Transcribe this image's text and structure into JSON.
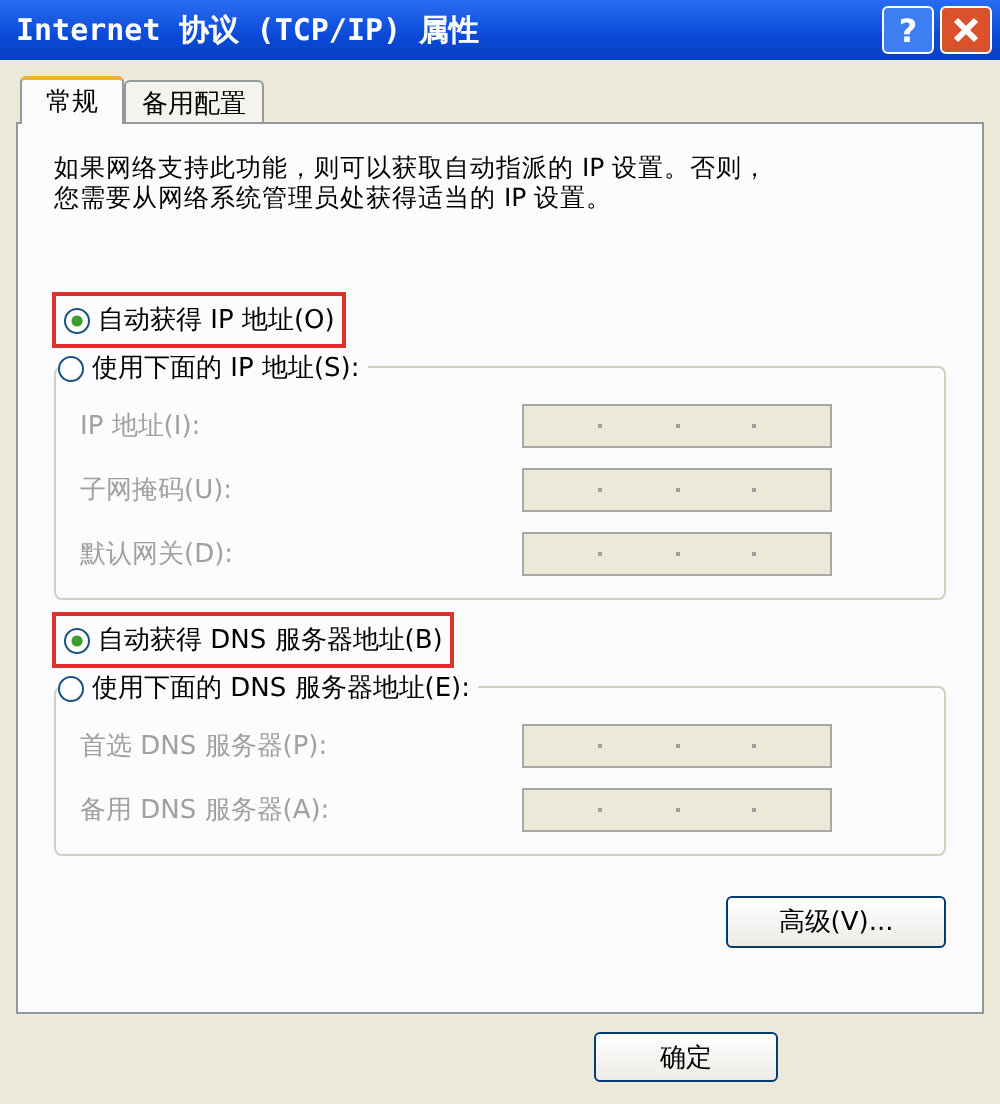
{
  "window": {
    "title": "Internet 协议 (TCP/IP) 属性",
    "help_button": "?"
  },
  "tabs": [
    {
      "label": "常规",
      "selected": true
    },
    {
      "label": "备用配置",
      "selected": false
    }
  ],
  "description_lines": [
    "如果网络支持此功能，则可以获取自动指派的 IP 设置。否则，",
    "您需要从网络系统管理员处获得适当的 IP 设置。"
  ],
  "sections": [
    {
      "auto_option": {
        "label": "自动获得 IP 地址(O)",
        "selected": true,
        "highlighted": true
      },
      "manual_option": {
        "label": "使用下面的 IP 地址(S):",
        "selected": false
      },
      "fields": [
        {
          "label": "IP 地址(I):",
          "disabled": true
        },
        {
          "label": "子网掩码(U):",
          "disabled": true
        },
        {
          "label": "默认网关(D):",
          "disabled": true
        }
      ]
    },
    {
      "auto_option": {
        "label": "自动获得 DNS 服务器地址(B)",
        "selected": true,
        "highlighted": true
      },
      "manual_option": {
        "label": "使用下面的 DNS 服务器地址(E):",
        "selected": false
      },
      "fields": [
        {
          "label": "首选 DNS 服务器(P):",
          "disabled": true
        },
        {
          "label": "备用 DNS 服务器(A):",
          "disabled": true
        }
      ]
    }
  ],
  "advanced_button": "高级(V)...",
  "ok_button": "确定"
}
